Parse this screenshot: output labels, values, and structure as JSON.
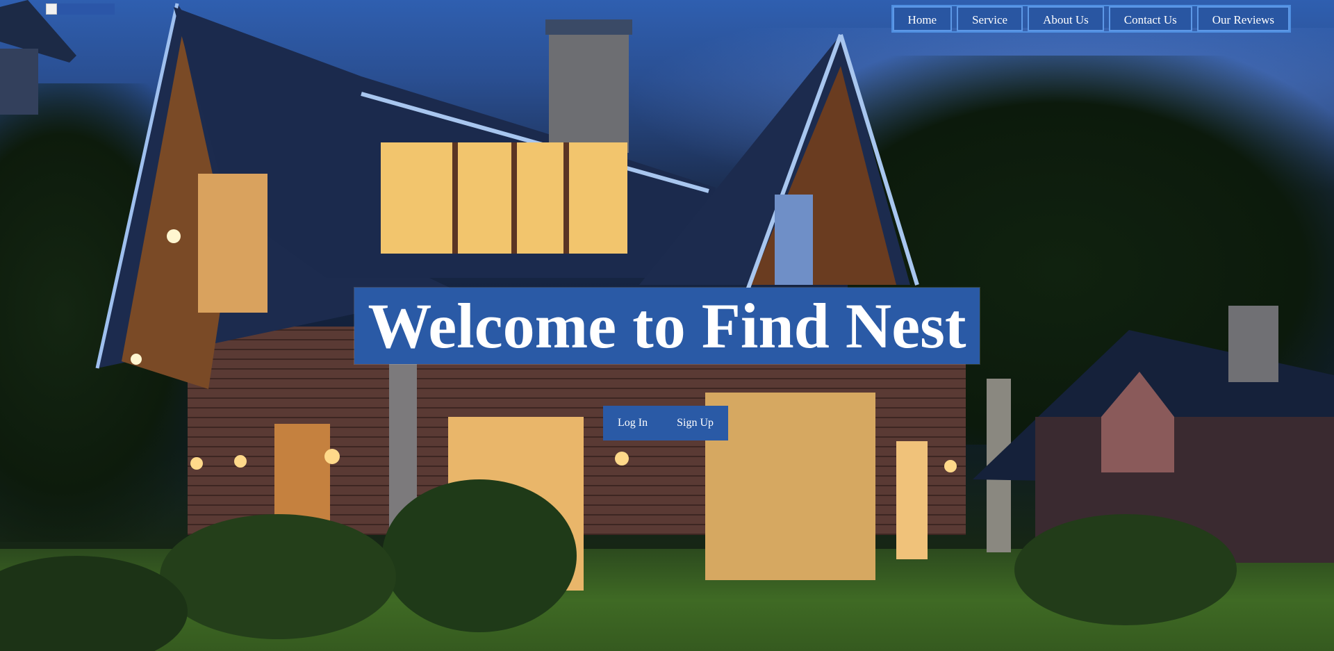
{
  "site": {
    "logo_alt": "",
    "nav": [
      {
        "label": "Home"
      },
      {
        "label": "Service"
      },
      {
        "label": "About Us"
      },
      {
        "label": "Contact Us"
      },
      {
        "label": "Our Reviews"
      }
    ]
  },
  "hero": {
    "heading": "Welcome to Find Nest",
    "login_label": "Log In",
    "signup_label": "Sign Up",
    "background_image": "house-at-night-photo"
  },
  "colors": {
    "accent_blue": "#2a5aa6",
    "nav_border": "#4e8ee0",
    "text": "#ffffff"
  }
}
